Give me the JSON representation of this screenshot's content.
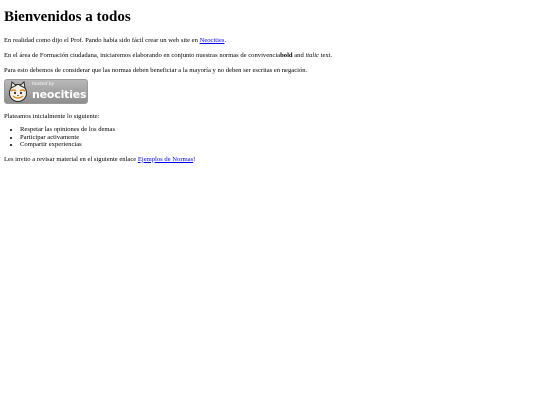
{
  "heading": "Bienvenidos a todos",
  "intro": {
    "before": "En realidad como dijo el Prof. Pando había sido fácil crear un web site en ",
    "link": "Neocities",
    "after": "."
  },
  "area": {
    "before": "En el área de Formación ciudadana, iniciaremos elaborando en conjunto nuestras normas de convivencia",
    "bold": "bold",
    "middle": " and ",
    "italic": "italic",
    "after": " text."
  },
  "norms_note": "Para esto debemos de considerar que las normas deben beneficiar a la mayoría y no deben ser escritas en negación.",
  "badge": {
    "small": "hosted by",
    "big": "neocities"
  },
  "list_intro": "Plateamos inicialmente lo siguiente:",
  "list_items": [
    "Respetar las opiniones de los demas",
    "Participar activamente",
    "Compartir experiencias"
  ],
  "outro": {
    "before": "Les invito a revisar material en el siguiente enlace ",
    "link": "Ejemplos de Normas",
    "after": "!"
  }
}
